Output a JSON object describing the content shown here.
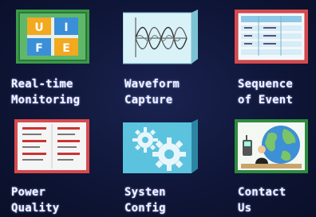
{
  "menu": {
    "items": [
      {
        "id": "realtime",
        "line1": "Real-time",
        "line2": "Monitoring",
        "icon": "realtime-ufe-icon",
        "icon_letters": [
          "U",
          "I",
          "F",
          "E"
        ]
      },
      {
        "id": "waveform",
        "line1": "Waveform",
        "line2": "Capture",
        "icon": "waveform-icon"
      },
      {
        "id": "soe",
        "line1": "Sequence",
        "line2": "of Event",
        "icon": "event-list-icon"
      },
      {
        "id": "power",
        "line1": "Power",
        "line2": "Quality",
        "icon": "power-quality-report-icon"
      },
      {
        "id": "config",
        "line1": "Systen",
        "line2": "Config",
        "icon": "gears-icon"
      },
      {
        "id": "contact",
        "line1": "Contact",
        "line2": "Us",
        "icon": "globe-contact-icon"
      }
    ]
  },
  "colors": {
    "background": "#0e1536",
    "label": "#f2f4ff",
    "tile_green": "#2e8b3e",
    "tile_cyan": "#bfe8f2",
    "tile_red": "#d8474a"
  }
}
